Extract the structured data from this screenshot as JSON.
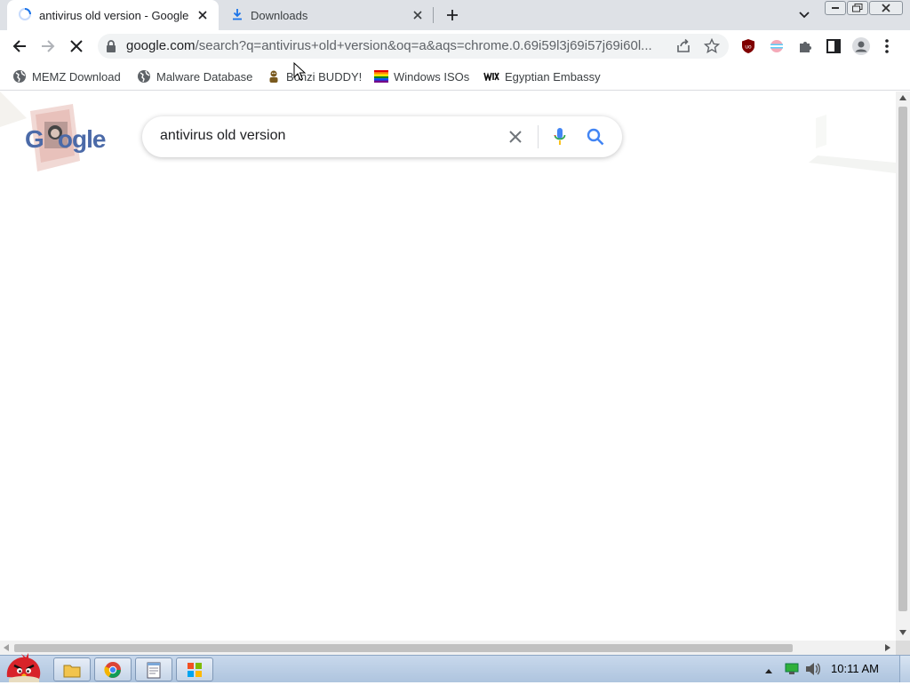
{
  "tabs": [
    {
      "title": "antivirus old version - Google",
      "icon": "loading-spinner",
      "active": true
    },
    {
      "title": "Downloads",
      "icon": "download-icon",
      "active": false
    }
  ],
  "address_bar": {
    "url_host": "google.com",
    "url_rest": "/search?q=antivirus+old+version&oq=a&aqs=chrome.0.69i59l3j69i57j69i60l..."
  },
  "bookmarks": [
    {
      "label": "MEMZ Download",
      "icon": "globe-icon"
    },
    {
      "label": "Malware Database",
      "icon": "globe-icon"
    },
    {
      "label": "Bonzi BUDDY!",
      "icon": "bonzi-icon"
    },
    {
      "label": "Windows ISOs",
      "icon": "rainbow-flag-icon"
    },
    {
      "label": "Egyptian Embassy",
      "icon": "wix-icon"
    }
  ],
  "search": {
    "query": "antivirus old version",
    "logo_text": "Google"
  },
  "taskbar": {
    "time": "10:11 AM"
  },
  "colors": {
    "tab_strip": "#dee1e6",
    "google_blue": "#4285f4",
    "google_red": "#ea4335",
    "google_yellow": "#fbbc05",
    "google_green": "#34a853",
    "taskbar": "#b9cde5"
  }
}
